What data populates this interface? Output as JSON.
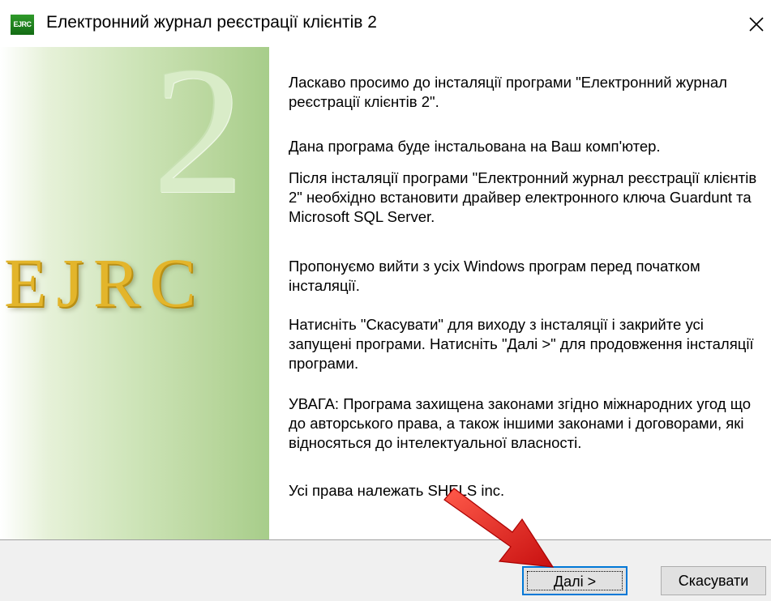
{
  "window": {
    "title": "Електронний журнал реєстрації клієнтів 2",
    "icon_text": "EJRC",
    "icon": "app-icon",
    "close_icon": "close-icon"
  },
  "banner": {
    "number": "2",
    "logo": "EJRC"
  },
  "content": {
    "paragraphs": [
      "Ласкаво просимо до інсталяції програми \"Електронний журнал реєстрації клієнтів 2\".",
      "Дана програма буде інстальована на Ваш комп'ютер.",
      "Після інсталяції програми \"Електронний журнал реєстрації клієнтів 2\" необхідно встановити драйвер електронного ключа Guardunt та Microsoft SQL Server.",
      "Пропонуємо вийти з усіх Windows програм перед початком інсталяції.",
      "Натисніть \"Скасувати\" для виходу з інсталяції і закрийте усі запущені програми. Натисніть \"Далі >\" для продовження інсталяції програми.",
      "УВАГА: Програма захищена законами згідно міжнародних угод що до авторського права, а також іншими законами і договорами, які відносяться до інтелектуальної власності.",
      "Усі права належать SHELS inc."
    ]
  },
  "footer": {
    "next_label": "Далі >",
    "cancel_label": "Скасувати"
  },
  "annotation": {
    "icon": "red-arrow-icon",
    "color": "#e02020"
  },
  "colors": {
    "panel_green": "#b8d69c",
    "logo_gold": "#e3b52b",
    "focus_blue": "#0078d7"
  }
}
